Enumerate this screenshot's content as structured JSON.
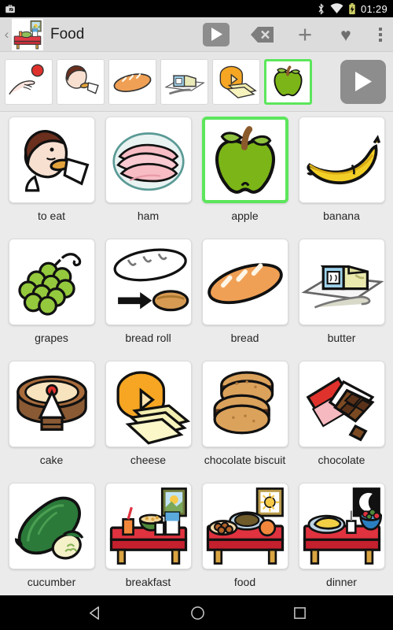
{
  "statusbar": {
    "time": "01:29",
    "icons": [
      "briefcase-icon",
      "bluetooth-icon",
      "wifi-icon",
      "battery-charging-icon"
    ]
  },
  "toolbar": {
    "back_label": "‹",
    "app_icon": "breakfast-table-icon",
    "title": "Food",
    "play_label": "play-icon",
    "delete_label": "backspace-icon",
    "add_label": "+",
    "favorite_label": "♥",
    "overflow_label": "overflow-menu-icon"
  },
  "sentence_bar": {
    "items": [
      {
        "name": "hand-ball",
        "symbol": "hand-ball",
        "selected": false
      },
      {
        "name": "to eat",
        "symbol": "to-eat",
        "selected": false
      },
      {
        "name": "bread",
        "symbol": "bread",
        "selected": false
      },
      {
        "name": "butter",
        "symbol": "butter",
        "selected": false
      },
      {
        "name": "cheese",
        "symbol": "cheese",
        "selected": false
      },
      {
        "name": "apple",
        "symbol": "apple",
        "selected": true
      }
    ],
    "play_label": "play-icon"
  },
  "grid": {
    "columns": 4,
    "cells": [
      {
        "label": "to eat",
        "symbol": "to-eat",
        "selected": false
      },
      {
        "label": "ham",
        "symbol": "ham",
        "selected": false
      },
      {
        "label": "apple",
        "symbol": "apple",
        "selected": true
      },
      {
        "label": "banana",
        "symbol": "banana",
        "selected": false
      },
      {
        "label": "grapes",
        "symbol": "grapes",
        "selected": false
      },
      {
        "label": "bread roll",
        "symbol": "bread-roll",
        "selected": false
      },
      {
        "label": "bread",
        "symbol": "bread",
        "selected": false
      },
      {
        "label": "butter",
        "symbol": "butter",
        "selected": false
      },
      {
        "label": "cake",
        "symbol": "cake",
        "selected": false
      },
      {
        "label": "cheese",
        "symbol": "cheese",
        "selected": false
      },
      {
        "label": "chocolate biscuit",
        "symbol": "chocolate-biscuit",
        "selected": false
      },
      {
        "label": "chocolate",
        "symbol": "chocolate",
        "selected": false
      },
      {
        "label": "cucumber",
        "symbol": "cucumber",
        "selected": false
      },
      {
        "label": "breakfast",
        "symbol": "breakfast",
        "selected": false
      },
      {
        "label": "food",
        "symbol": "food",
        "selected": false
      },
      {
        "label": "dinner",
        "symbol": "dinner",
        "selected": false
      }
    ]
  },
  "navbar": {
    "back_label": "back-triangle-icon",
    "home_label": "home-circle-icon",
    "recents_label": "recents-square-icon"
  },
  "colors": {
    "selection": "#5ce65c",
    "toolbar_bg": "#dcdcdc",
    "page_bg": "#ebebeb",
    "accent_gray": "#8d8d8d"
  }
}
